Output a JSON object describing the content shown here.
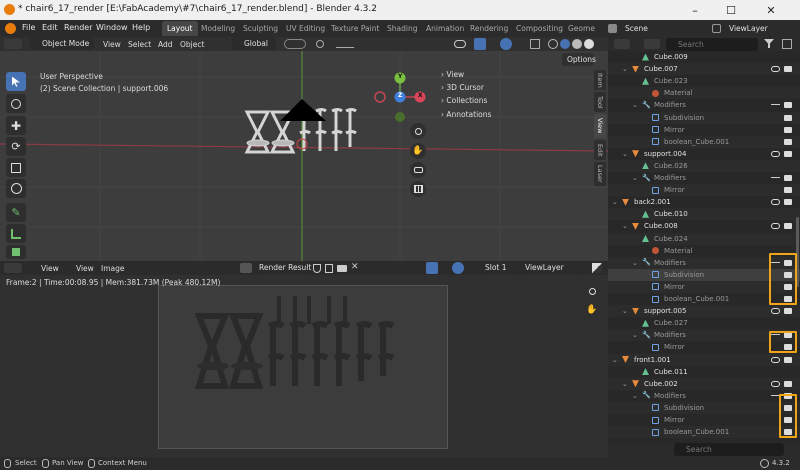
{
  "titlebar": {
    "title": "* chair6_17_render [E:\\FabAcademy\\#7\\chair6_17_render.blend] - Blender 4.3.2"
  },
  "menus": [
    "File",
    "Edit",
    "Render",
    "Window",
    "Help"
  ],
  "workspaces": {
    "active": "Layout",
    "tabs": [
      "Layout",
      "Modeling",
      "Sculpting",
      "UV Editing",
      "Texture Paint",
      "Shading",
      "Animation",
      "Rendering",
      "Compositing",
      "Geome"
    ]
  },
  "scene": {
    "name": "Scene",
    "view_layer": "ViewLayer"
  },
  "viewport": {
    "mode": "Object Mode",
    "menus": [
      "View",
      "Select",
      "Add",
      "Object"
    ],
    "transform": "Global",
    "options": "Options",
    "info_line1": "User Perspective",
    "info_line2": "(2) Scene Collection | support.006",
    "panels": [
      "View",
      "3D Cursor",
      "Collections",
      "Annotations"
    ],
    "side_tabs": [
      "Item",
      "Tool",
      "View",
      "Edit",
      "Laser"
    ],
    "gizmo": {
      "y": "Y",
      "x": "X",
      "z": "Z"
    }
  },
  "image_editor": {
    "menus": [
      "View",
      "View",
      "Image"
    ],
    "image_name": "Render Result",
    "slot": "Slot 1",
    "layer": "ViewLayer",
    "stats": "Frame:2 | Time:00:08.95 | Mem:381.73M (Peak 480.12M)"
  },
  "outliner": {
    "search_placeholder": "Search",
    "bottom_search_placeholder": "Search",
    "rows": [
      {
        "indent": 2,
        "label": "Cube.009",
        "icon": "mesh",
        "color": "#e0e0e0",
        "alt": false
      },
      {
        "indent": 1,
        "label": "Cube.007",
        "icon": "object",
        "color": "#e0e0e0",
        "alt": true
      },
      {
        "indent": 2,
        "label": "Cube.023",
        "icon": "mesh",
        "color": "#9a9a9a",
        "alt": false
      },
      {
        "indent": 3,
        "label": "Material",
        "icon": "material",
        "color": "#9a9a9a",
        "alt": true
      },
      {
        "indent": 2,
        "label": "Modifiers",
        "icon": "wrench",
        "color": "#9a9a9a",
        "alt": false
      },
      {
        "indent": 3,
        "label": "Subdivision",
        "icon": "modifier",
        "color": "#9a9a9a",
        "alt": true
      },
      {
        "indent": 3,
        "label": "Mirror",
        "icon": "modifier",
        "color": "#9a9a9a",
        "alt": false
      },
      {
        "indent": 3,
        "label": "boolean_Cube.001",
        "icon": "modifier",
        "color": "#9a9a9a",
        "alt": true
      },
      {
        "indent": 1,
        "label": "support.004",
        "icon": "object",
        "color": "#e0e0e0",
        "alt": false
      },
      {
        "indent": 2,
        "label": "Cube.026",
        "icon": "mesh",
        "color": "#9a9a9a",
        "alt": true
      },
      {
        "indent": 2,
        "label": "Modifiers",
        "icon": "wrench",
        "color": "#9a9a9a",
        "alt": false
      },
      {
        "indent": 3,
        "label": "Mirror",
        "icon": "modifier",
        "color": "#9a9a9a",
        "alt": true
      },
      {
        "indent": 0,
        "label": "back2.001",
        "icon": "object",
        "color": "#e0e0e0",
        "alt": false
      },
      {
        "indent": 2,
        "label": "Cube.010",
        "icon": "mesh",
        "color": "#e0e0e0",
        "alt": true
      },
      {
        "indent": 1,
        "label": "Cube.008",
        "icon": "object",
        "color": "#e0e0e0",
        "alt": false
      },
      {
        "indent": 2,
        "label": "Cube.024",
        "icon": "mesh",
        "color": "#9a9a9a",
        "alt": true
      },
      {
        "indent": 3,
        "label": "Material",
        "icon": "material",
        "color": "#9a9a9a",
        "alt": false
      },
      {
        "indent": 2,
        "label": "Modifiers",
        "icon": "wrench",
        "color": "#9a9a9a",
        "alt": true
      },
      {
        "indent": 3,
        "label": "Subdivision",
        "icon": "modifier",
        "color": "#9a9a9a",
        "alt": false,
        "hl": true
      },
      {
        "indent": 3,
        "label": "Mirror",
        "icon": "modifier",
        "color": "#9a9a9a",
        "alt": true
      },
      {
        "indent": 3,
        "label": "boolean_Cube.001",
        "icon": "modifier",
        "color": "#9a9a9a",
        "alt": false
      },
      {
        "indent": 1,
        "label": "support.005",
        "icon": "object",
        "color": "#e0e0e0",
        "alt": true
      },
      {
        "indent": 2,
        "label": "Cube.027",
        "icon": "mesh",
        "color": "#9a9a9a",
        "alt": false
      },
      {
        "indent": 2,
        "label": "Modifiers",
        "icon": "wrench",
        "color": "#9a9a9a",
        "alt": true
      },
      {
        "indent": 3,
        "label": "Mirror",
        "icon": "modifier",
        "color": "#9a9a9a",
        "alt": false
      },
      {
        "indent": 0,
        "label": "front1.001",
        "icon": "object",
        "color": "#e0e0e0",
        "alt": true
      },
      {
        "indent": 2,
        "label": "Cube.011",
        "icon": "mesh",
        "color": "#e0e0e0",
        "alt": false
      },
      {
        "indent": 1,
        "label": "Cube.002",
        "icon": "object",
        "color": "#e0e0e0",
        "alt": true
      },
      {
        "indent": 2,
        "label": "Modifiers",
        "icon": "wrench",
        "color": "#9a9a9a",
        "alt": false
      },
      {
        "indent": 3,
        "label": "Subdivision",
        "icon": "modifier",
        "color": "#9a9a9a",
        "alt": true
      },
      {
        "indent": 3,
        "label": "Mirror",
        "icon": "modifier",
        "color": "#9a9a9a",
        "alt": false
      },
      {
        "indent": 3,
        "label": "boolean_Cube.001",
        "icon": "modifier",
        "color": "#9a9a9a",
        "alt": true
      }
    ]
  },
  "status": {
    "select": "Select",
    "pan": "Pan View",
    "context": "Context Menu",
    "version": "4.3.2"
  },
  "colors": {
    "accent": "#4772b3",
    "highlight": "#f0a41a",
    "object": "#e88a3c",
    "mesh": "#63c28f",
    "modifier": "#6ea2e0"
  }
}
